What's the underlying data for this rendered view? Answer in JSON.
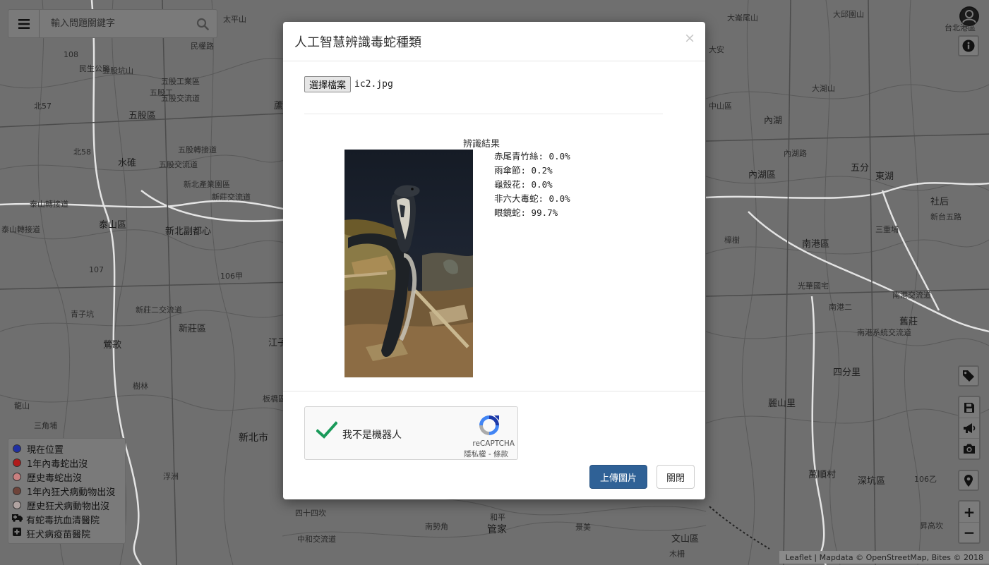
{
  "search": {
    "placeholder": "輸入問題關鍵字"
  },
  "map_labels": [
    "108",
    "民生公路",
    "民權路",
    "太平山",
    "大崙尾山",
    "大邱園山",
    "五股坑山",
    "五股工",
    "五股工業區",
    "五股區",
    "五股交流道",
    "五股轉接道",
    "五股交流道",
    "蘆洲",
    "北57",
    "北58",
    "水碓",
    "泰山轉接道",
    "泰山區",
    "泰山轉接道",
    "新北產業園區",
    "新北副都心",
    "新莊區",
    "新莊交流道",
    "新莊二交流道",
    "青子坑",
    "鶯歌",
    "樹林",
    "三角埔",
    "龍山",
    "浮洲",
    "新北市",
    "板橋區",
    "江子",
    "107",
    "106甲",
    "大安",
    "中山區",
    "內湖",
    "內湖區",
    "內湖路",
    "大湖山",
    "南港區",
    "南港二",
    "四分里",
    "深坑區",
    "舊莊",
    "麗山里",
    "萬順村",
    "木柵",
    "文山區",
    "景美",
    "四十四坎",
    "中和交流道",
    "南勢角",
    "管家",
    "和平",
    "106乙",
    "昇高坎",
    "五分",
    "東湖",
    "社后",
    "三重埔",
    "樟樹",
    "光華國宅",
    "南港系統交流道",
    "南港交流道",
    "新台五路",
    "台北港區"
  ],
  "avatar": {
    "icon": "user-icon"
  },
  "controls": {
    "info": "info-icon",
    "tag": "tag-icon",
    "save": "save-icon",
    "announce": "megaphone-icon",
    "camera": "camera-icon",
    "location": "location-pin-icon",
    "zoom_in": "+",
    "zoom_out": "−"
  },
  "legend": {
    "items": [
      {
        "label": "現在位置",
        "color": "#1f2fa3",
        "type": "dot"
      },
      {
        "label": "1年內毒蛇出沒",
        "color": "#b01a1a",
        "type": "dot"
      },
      {
        "label": "歷史毒蛇出沒",
        "color": "#c98080",
        "type": "dot"
      },
      {
        "label": "1年內狂犬病動物出沒",
        "color": "#6e4339",
        "type": "dot"
      },
      {
        "label": "歷史狂犬病動物出沒",
        "color": "#b0a3a1",
        "type": "dot"
      },
      {
        "label": "有蛇毒抗血清醫院",
        "icon": "ambulance-icon",
        "type": "icon"
      },
      {
        "label": "狂犬病疫苗醫院",
        "icon": "plus-square-icon",
        "type": "icon"
      }
    ]
  },
  "attribution": "Leaflet | Mapdata © OpenStreetMap, Bites © 2018",
  "modal": {
    "title": "人工智慧辨識毒蛇種類",
    "close": "×",
    "file_button": "選擇檔案",
    "file_name": "ic2.jpg",
    "result_title": "辨識結果",
    "results": [
      "赤尾青竹絲: 0.0%",
      "雨傘節: 0.2%",
      "龜殼花: 0.0%",
      "非六大毒蛇: 0.0%",
      "眼鏡蛇: 99.7%"
    ],
    "recaptcha": {
      "label": "我不是機器人",
      "brand": "reCAPTCHA",
      "terms": "隱私權 - 條款"
    },
    "upload_button": "上傳圖片",
    "close_button": "關閉"
  },
  "colors": {
    "primary": "#2f6196",
    "check_green": "#1a9a5a"
  }
}
